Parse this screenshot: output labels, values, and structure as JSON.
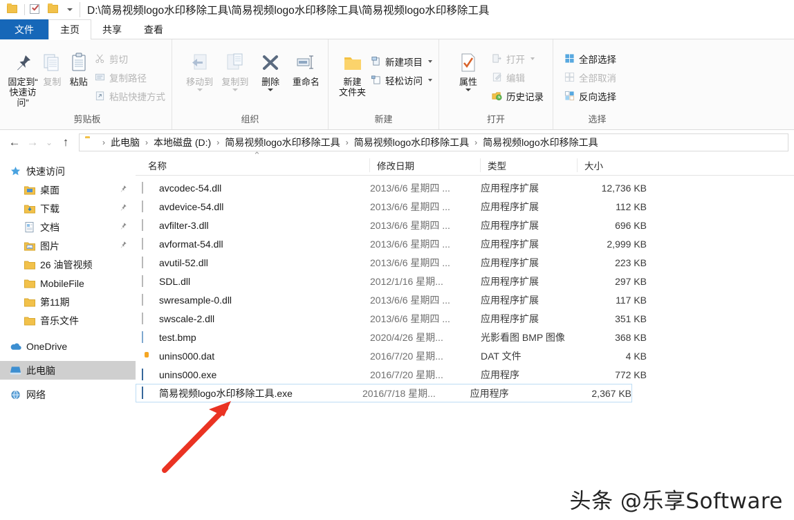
{
  "window": {
    "title_path": "D:\\简易视频logo水印移除工具\\简易视频logo水印移除工具\\简易视频logo水印移除工具",
    "quick_access": [
      {
        "name": "folder-icon",
        "label": "文件夹"
      },
      {
        "name": "properties-icon",
        "label": "属性"
      },
      {
        "name": "new-folder-icon",
        "label": "新建文件夹"
      },
      {
        "name": "customize-caret",
        "label": "自定义快速访问工具栏"
      }
    ]
  },
  "tabs": [
    {
      "label": "文件",
      "name": "tab-file"
    },
    {
      "label": "主页",
      "name": "tab-home"
    },
    {
      "label": "共享",
      "name": "tab-share"
    },
    {
      "label": "查看",
      "name": "tab-view"
    }
  ],
  "ribbon": {
    "groups": [
      {
        "title": "剪贴板",
        "big": [
          {
            "label": "固定到“\n快速访问”",
            "label_line1": "固定到“",
            "label_line2": "快速访问”",
            "icon": "pin-icon",
            "dim": false
          },
          {
            "label": "复制",
            "icon": "copy-icon",
            "dim": true
          },
          {
            "label": "粘贴",
            "icon": "paste-icon",
            "dim": false
          }
        ],
        "small": [
          {
            "label": "剪切",
            "icon": "scissors-icon",
            "dim": true
          },
          {
            "label": "复制路径",
            "icon": "copy-path-icon",
            "dim": true
          },
          {
            "label": "粘贴快捷方式",
            "icon": "paste-shortcut-icon",
            "dim": true
          }
        ]
      },
      {
        "title": "组织",
        "big": [
          {
            "label": "移动到",
            "icon": "move-to-icon",
            "dim": true,
            "caret": true
          },
          {
            "label": "复制到",
            "icon": "copy-to-icon",
            "dim": true,
            "caret": true
          },
          {
            "label": "删除",
            "icon": "delete-icon",
            "dim": false,
            "caret": true
          },
          {
            "label": "重命名",
            "icon": "rename-icon",
            "dim": false,
            "caret": false
          }
        ],
        "small": []
      },
      {
        "title": "新建",
        "big": [
          {
            "label_line1": "新建",
            "label_line2": "文件夹",
            "icon": "new-folder-icon",
            "dim": false
          }
        ],
        "small": [
          {
            "label": "新建项目",
            "icon": "new-item-icon",
            "dim": false,
            "caret": true
          },
          {
            "label": "轻松访问",
            "icon": "easy-access-icon",
            "dim": false,
            "caret": true
          }
        ]
      },
      {
        "title": "打开",
        "big": [
          {
            "label": "属性",
            "icon": "properties-icon",
            "dim": false,
            "caret": true
          }
        ],
        "small": [
          {
            "label": "打开",
            "icon": "open-icon",
            "dim": true,
            "caret": true
          },
          {
            "label": "编辑",
            "icon": "edit-icon",
            "dim": true,
            "caret": false
          },
          {
            "label": "历史记录",
            "icon": "history-icon",
            "dim": false,
            "caret": false
          }
        ]
      },
      {
        "title": "选择",
        "big": [],
        "small": [
          {
            "label": "全部选择",
            "icon": "select-all-icon",
            "dim": false
          },
          {
            "label": "全部取消",
            "icon": "select-none-icon",
            "dim": true
          },
          {
            "label": "反向选择",
            "icon": "invert-selection-icon",
            "dim": false
          }
        ]
      }
    ]
  },
  "address": {
    "back": "←",
    "forward": "→",
    "recent": "⌄",
    "up": "↑",
    "separator": "›",
    "crumbs": [
      "此电脑",
      "本地磁盘 (D:)",
      "简易视频logo水印移除工具",
      "简易视频logo水印移除工具",
      "简易视频logo水印移除工具"
    ]
  },
  "sidebar": {
    "items": [
      {
        "label": "快速访问",
        "icon": "star-icon",
        "level": 0,
        "pinned": false,
        "selected": false
      },
      {
        "label": "桌面",
        "icon": "desktop-folder-icon",
        "level": 1,
        "pinned": true,
        "selected": false
      },
      {
        "label": "下载",
        "icon": "downloads-folder-icon",
        "level": 1,
        "pinned": true,
        "selected": false
      },
      {
        "label": "文档",
        "icon": "documents-folder-icon",
        "level": 1,
        "pinned": true,
        "selected": false
      },
      {
        "label": "图片",
        "icon": "pictures-folder-icon",
        "level": 1,
        "pinned": true,
        "selected": false
      },
      {
        "label": "26 油管视频",
        "icon": "folder-icon",
        "level": 1,
        "pinned": false,
        "selected": false
      },
      {
        "label": "MobileFile",
        "icon": "folder-icon",
        "level": 1,
        "pinned": false,
        "selected": false
      },
      {
        "label": "第11期",
        "icon": "folder-icon",
        "level": 1,
        "pinned": false,
        "selected": false
      },
      {
        "label": "音乐文件",
        "icon": "folder-icon",
        "level": 1,
        "pinned": false,
        "selected": false
      },
      {
        "label": "OneDrive",
        "icon": "onedrive-cloud-icon",
        "level": 0,
        "pinned": false,
        "selected": false
      },
      {
        "label": "此电脑",
        "icon": "this-pc-icon",
        "level": 0,
        "pinned": false,
        "selected": true
      },
      {
        "label": "网络",
        "icon": "network-icon",
        "level": 0,
        "pinned": false,
        "selected": false
      }
    ],
    "pin_glyph": "📌"
  },
  "filelist": {
    "columns": [
      {
        "label": "名称",
        "key": "name"
      },
      {
        "label": "修改日期",
        "key": "date"
      },
      {
        "label": "类型",
        "key": "type"
      },
      {
        "label": "大小",
        "key": "size"
      }
    ],
    "sort_indicator": "⌃",
    "rows": [
      {
        "name": "avcodec-54.dll",
        "date": "2013/6/6 星期四 ...",
        "type": "应用程序扩展",
        "size": "12,736 KB",
        "icon": "dll-file-icon",
        "selected": false
      },
      {
        "name": "avdevice-54.dll",
        "date": "2013/6/6 星期四 ...",
        "type": "应用程序扩展",
        "size": "112 KB",
        "icon": "dll-file-icon",
        "selected": false
      },
      {
        "name": "avfilter-3.dll",
        "date": "2013/6/6 星期四 ...",
        "type": "应用程序扩展",
        "size": "696 KB",
        "icon": "dll-file-icon",
        "selected": false
      },
      {
        "name": "avformat-54.dll",
        "date": "2013/6/6 星期四 ...",
        "type": "应用程序扩展",
        "size": "2,999 KB",
        "icon": "dll-file-icon",
        "selected": false
      },
      {
        "name": "avutil-52.dll",
        "date": "2013/6/6 星期四 ...",
        "type": "应用程序扩展",
        "size": "223 KB",
        "icon": "dll-file-icon",
        "selected": false
      },
      {
        "name": "SDL.dll",
        "date": "2012/1/16 星期...",
        "type": "应用程序扩展",
        "size": "297 KB",
        "icon": "dll-file-icon",
        "selected": false
      },
      {
        "name": "swresample-0.dll",
        "date": "2013/6/6 星期四 ...",
        "type": "应用程序扩展",
        "size": "117 KB",
        "icon": "dll-file-icon",
        "selected": false
      },
      {
        "name": "swscale-2.dll",
        "date": "2013/6/6 星期四 ...",
        "type": "应用程序扩展",
        "size": "351 KB",
        "icon": "dll-file-icon",
        "selected": false
      },
      {
        "name": "test.bmp",
        "date": "2020/4/26 星期...",
        "type": "光影看图 BMP 图像",
        "size": "368 KB",
        "icon": "bmp-file-icon",
        "selected": false
      },
      {
        "name": "unins000.dat",
        "date": "2016/7/20 星期...",
        "type": "DAT 文件",
        "size": "4 KB",
        "icon": "dat-file-icon",
        "selected": false
      },
      {
        "name": "unins000.exe",
        "date": "2016/7/20 星期...",
        "type": "应用程序",
        "size": "772 KB",
        "icon": "exe-file-icon",
        "selected": false
      },
      {
        "name": "简易视频logo水印移除工具.exe",
        "date": "2016/7/18 星期...",
        "type": "应用程序",
        "size": "2,367 KB",
        "icon": "exe-file-icon",
        "selected": true
      }
    ]
  },
  "annotation": {
    "arrow_color": "#ea3323",
    "arrow_target": "简易视频logo水印移除工具.exe"
  },
  "watermark": {
    "text": "头条 @乐享Software"
  },
  "colors": {
    "file_tab_blue": "#1667b8",
    "selection_gray": "#cfcfcf",
    "selection_border": "#bcdcf4",
    "arrow_red": "#ea3323"
  }
}
